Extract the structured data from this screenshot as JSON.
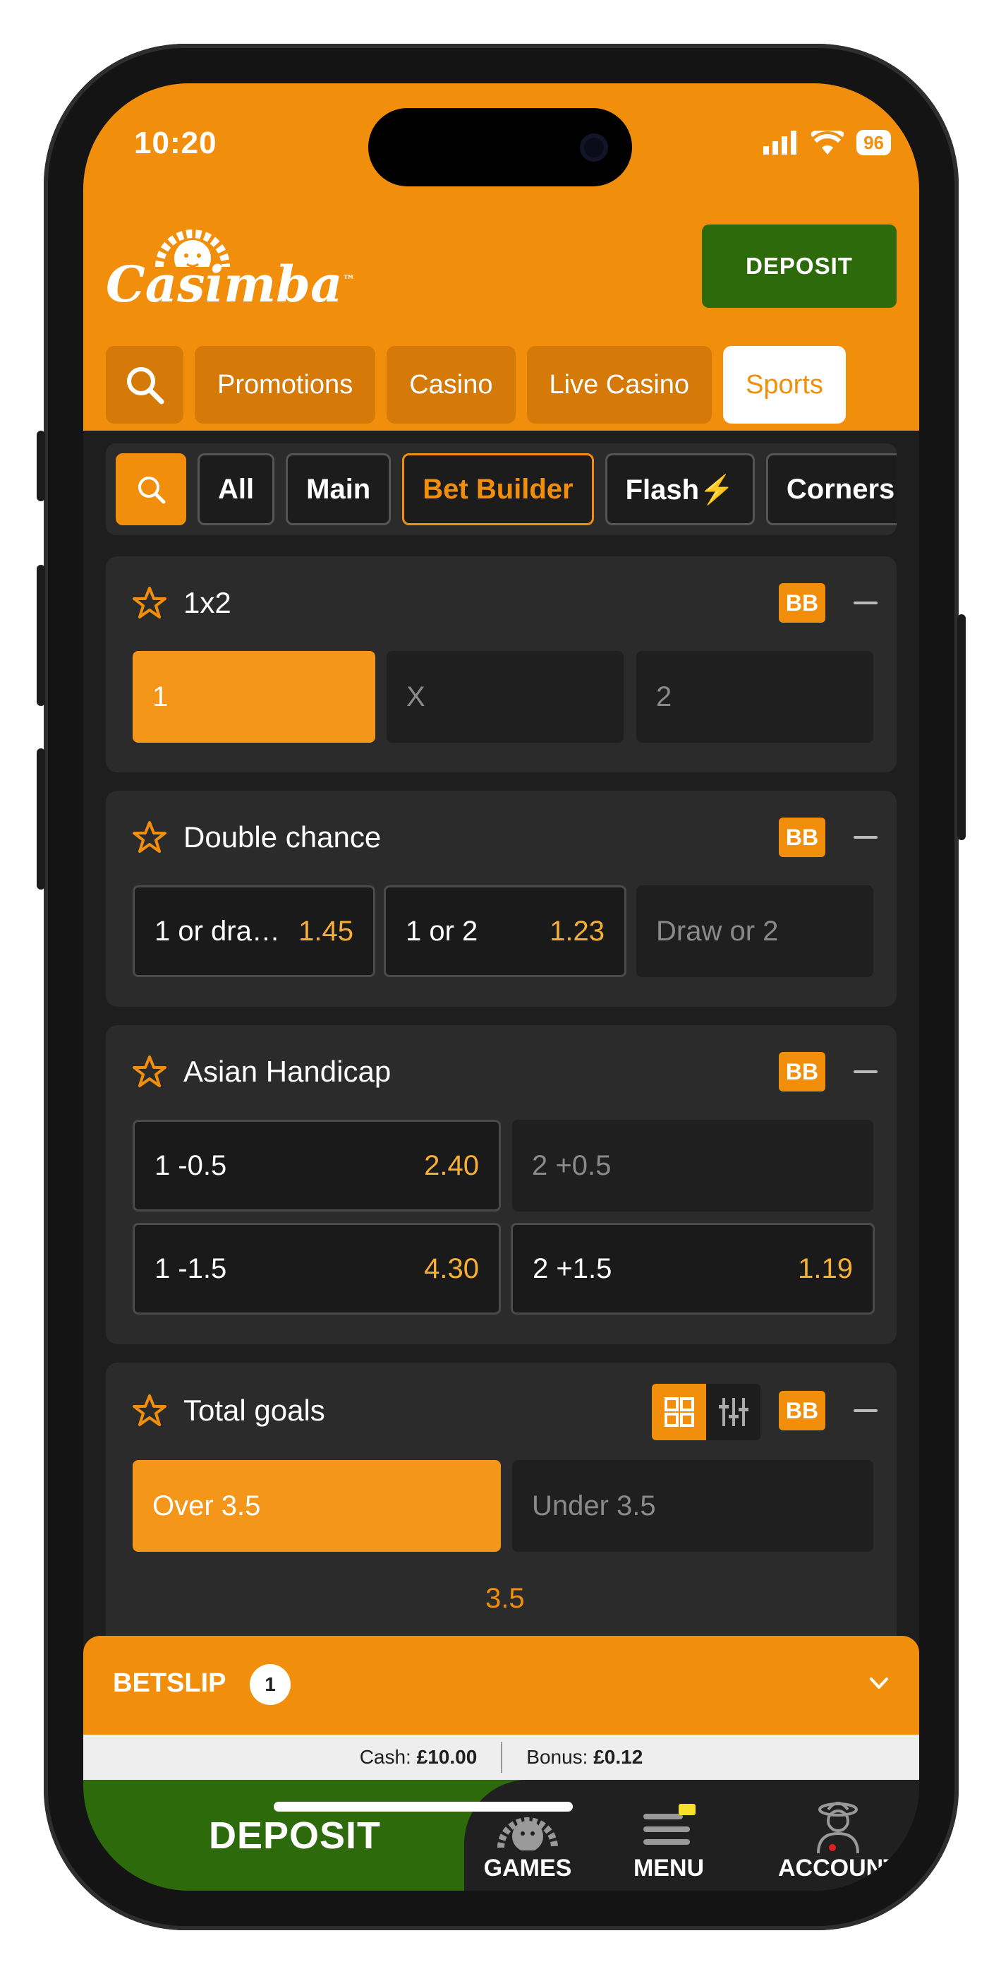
{
  "status": {
    "time": "10:20",
    "battery": "96"
  },
  "brand": {
    "name": "Casimba",
    "tm": "™"
  },
  "header": {
    "deposit_label": "DEPOSIT"
  },
  "top_nav": [
    "Promotions",
    "Casino",
    "Live Casino",
    "Sports"
  ],
  "top_nav_active": "Sports",
  "filters": [
    "All",
    "Main",
    "Bet Builder",
    "Flash⚡",
    "Corners"
  ],
  "filters_active": "Bet Builder",
  "markets": {
    "m1": {
      "title": "1x2",
      "bb": "BB",
      "outcomes": [
        {
          "label": "1",
          "price": ""
        },
        {
          "label": "X",
          "price": ""
        },
        {
          "label": "2",
          "price": ""
        }
      ]
    },
    "m2": {
      "title": "Double chance",
      "bb": "BB",
      "outcomes": [
        {
          "label": "1 or dra…",
          "price": "1.45"
        },
        {
          "label": "1 or 2",
          "price": "1.23"
        },
        {
          "label": "Draw or 2",
          "price": ""
        }
      ]
    },
    "m3": {
      "title": "Asian Handicap",
      "bb": "BB",
      "outcomes": [
        {
          "label": "1 -0.5",
          "price": "2.40"
        },
        {
          "label": "2 +0.5",
          "price": ""
        },
        {
          "label": "1 -1.5",
          "price": "4.30"
        },
        {
          "label": "2 +1.5",
          "price": "1.19"
        }
      ]
    },
    "m4": {
      "title": "Total goals",
      "bb": "BB",
      "outcomes": [
        {
          "label": "Over 3.5",
          "price": ""
        },
        {
          "label": "Under 3.5",
          "price": ""
        }
      ],
      "slider_value": "3.5"
    }
  },
  "betslip": {
    "label": "BETSLIP",
    "count": "1"
  },
  "balance": {
    "cash_label": "Cash:",
    "cash_value": "£10.00",
    "bonus_label": "Bonus:",
    "bonus_value": "£0.12"
  },
  "bottom": {
    "deposit_label": "DEPOSIT",
    "nav": [
      "GAMES",
      "MENU",
      "ACCOUNT"
    ]
  },
  "colors": {
    "accent": "#f18f0d",
    "deposit_green": "#2d6a0c",
    "price": "#f7b035"
  }
}
